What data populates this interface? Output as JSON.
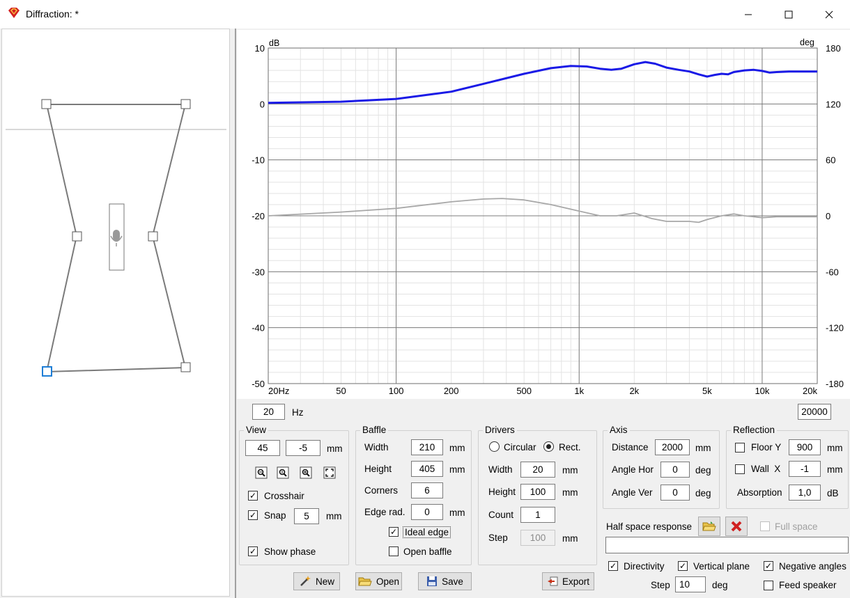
{
  "window": {
    "title": "Diffraction: *"
  },
  "chart_data": {
    "type": "line",
    "xlabel": "",
    "ylabel": "dB",
    "y2label": "deg",
    "xscale": "log",
    "xlim": [
      20,
      20000
    ],
    "ylim": [
      -50,
      10
    ],
    "y2lim": [
      -180,
      180
    ],
    "x_ticks": [
      {
        "v": 20,
        "t": "20Hz"
      },
      {
        "v": 50,
        "t": "50"
      },
      {
        "v": 100,
        "t": "100"
      },
      {
        "v": 200,
        "t": "200"
      },
      {
        "v": 500,
        "t": "500"
      },
      {
        "v": 1000,
        "t": "1k"
      },
      {
        "v": 2000,
        "t": "2k"
      },
      {
        "v": 5000,
        "t": "5k"
      },
      {
        "v": 10000,
        "t": "10k"
      },
      {
        "v": 20000,
        "t": "20k"
      }
    ],
    "y_ticks": [
      "10",
      "0",
      "-10",
      "-20",
      "-30",
      "-40",
      "-50"
    ],
    "y2_ticks": [
      "180",
      "120",
      "60",
      "0",
      "-60",
      "-120",
      "-180"
    ],
    "series": [
      {
        "color": "#1a1ae6",
        "axis": "left",
        "points": [
          [
            20,
            0.2
          ],
          [
            50,
            0.4
          ],
          [
            100,
            0.9
          ],
          [
            200,
            2.2
          ],
          [
            300,
            3.6
          ],
          [
            500,
            5.4
          ],
          [
            700,
            6.4
          ],
          [
            900,
            6.8
          ],
          [
            1100,
            6.7
          ],
          [
            1300,
            6.3
          ],
          [
            1500,
            6.1
          ],
          [
            1700,
            6.3
          ],
          [
            2000,
            7.1
          ],
          [
            2300,
            7.5
          ],
          [
            2600,
            7.2
          ],
          [
            3000,
            6.5
          ],
          [
            3500,
            6.1
          ],
          [
            4000,
            5.8
          ],
          [
            4500,
            5.3
          ],
          [
            5000,
            4.9
          ],
          [
            5500,
            5.2
          ],
          [
            6000,
            5.4
          ],
          [
            6500,
            5.3
          ],
          [
            7000,
            5.7
          ],
          [
            8000,
            6.0
          ],
          [
            9000,
            6.1
          ],
          [
            10000,
            5.9
          ],
          [
            11000,
            5.6
          ],
          [
            12000,
            5.7
          ],
          [
            14000,
            5.8
          ],
          [
            17000,
            5.8
          ],
          [
            20000,
            5.8
          ]
        ]
      },
      {
        "color": "#a8a8a8",
        "axis": "right",
        "points": [
          [
            20,
            0
          ],
          [
            50,
            4
          ],
          [
            100,
            8
          ],
          [
            200,
            15
          ],
          [
            300,
            18
          ],
          [
            380,
            18.6
          ],
          [
            500,
            17
          ],
          [
            700,
            12
          ],
          [
            1000,
            5
          ],
          [
            1300,
            0
          ],
          [
            1600,
            0
          ],
          [
            2000,
            3
          ],
          [
            2500,
            -3
          ],
          [
            3000,
            -6
          ],
          [
            3500,
            -6
          ],
          [
            4000,
            -6
          ],
          [
            4500,
            -7
          ],
          [
            5000,
            -4
          ],
          [
            6000,
            0
          ],
          [
            7000,
            2
          ],
          [
            8000,
            0
          ],
          [
            9000,
            -1
          ],
          [
            10000,
            -2
          ],
          [
            12000,
            -1
          ],
          [
            15000,
            -1
          ],
          [
            20000,
            -1
          ]
        ]
      }
    ]
  },
  "range": {
    "min": "20",
    "unit": "Hz",
    "max": "20000"
  },
  "view": {
    "title": "View",
    "x": "45",
    "y": "-5",
    "unit": "mm",
    "crosshair": "Crosshair",
    "snap": "Snap",
    "snap_value": "5",
    "snap_unit": "mm",
    "show_phase": "Show phase"
  },
  "baffle": {
    "title": "Baffle",
    "width_label": "Width",
    "width": "210",
    "width_unit": "mm",
    "height_label": "Height",
    "height": "405",
    "height_unit": "mm",
    "corners_label": "Corners",
    "corners": "6",
    "edge_label": "Edge rad.",
    "edge": "0",
    "edge_unit": "mm",
    "ideal_edge": "Ideal edge",
    "open_baffle": "Open baffle"
  },
  "drivers": {
    "title": "Drivers",
    "circular": "Circular",
    "rect": "Rect.",
    "width_label": "Width",
    "width": "20",
    "width_unit": "mm",
    "height_label": "Height",
    "height": "100",
    "height_unit": "mm",
    "count_label": "Count",
    "count": "1",
    "step_label": "Step",
    "step": "100",
    "step_unit": "mm"
  },
  "axis": {
    "title": "Axis",
    "distance_label": "Distance",
    "distance": "2000",
    "distance_unit": "mm",
    "hor_label": "Angle Hor",
    "hor": "0",
    "hor_unit": "deg",
    "ver_label": "Angle Ver",
    "ver": "0",
    "ver_unit": "deg"
  },
  "reflection": {
    "title": "Reflection",
    "floor_label": "Floor Y",
    "floor": "900",
    "floor_unit": "mm",
    "wall_label": "Wall  X",
    "wall": "-1",
    "wall_unit": "mm",
    "abs_label": "Absorption",
    "abs": "1,0",
    "abs_unit": "dB"
  },
  "halfspace": {
    "label": "Half space response",
    "full_space": "Full space",
    "path": ""
  },
  "options": {
    "directivity": "Directivity",
    "vertical": "Vertical plane",
    "negative": "Negative angles",
    "step_label": "Step",
    "step": "10",
    "step_unit": "deg",
    "feed": "Feed speaker"
  },
  "buttons": {
    "new": "New",
    "open": "Open",
    "save": "Save",
    "export": "Export"
  }
}
